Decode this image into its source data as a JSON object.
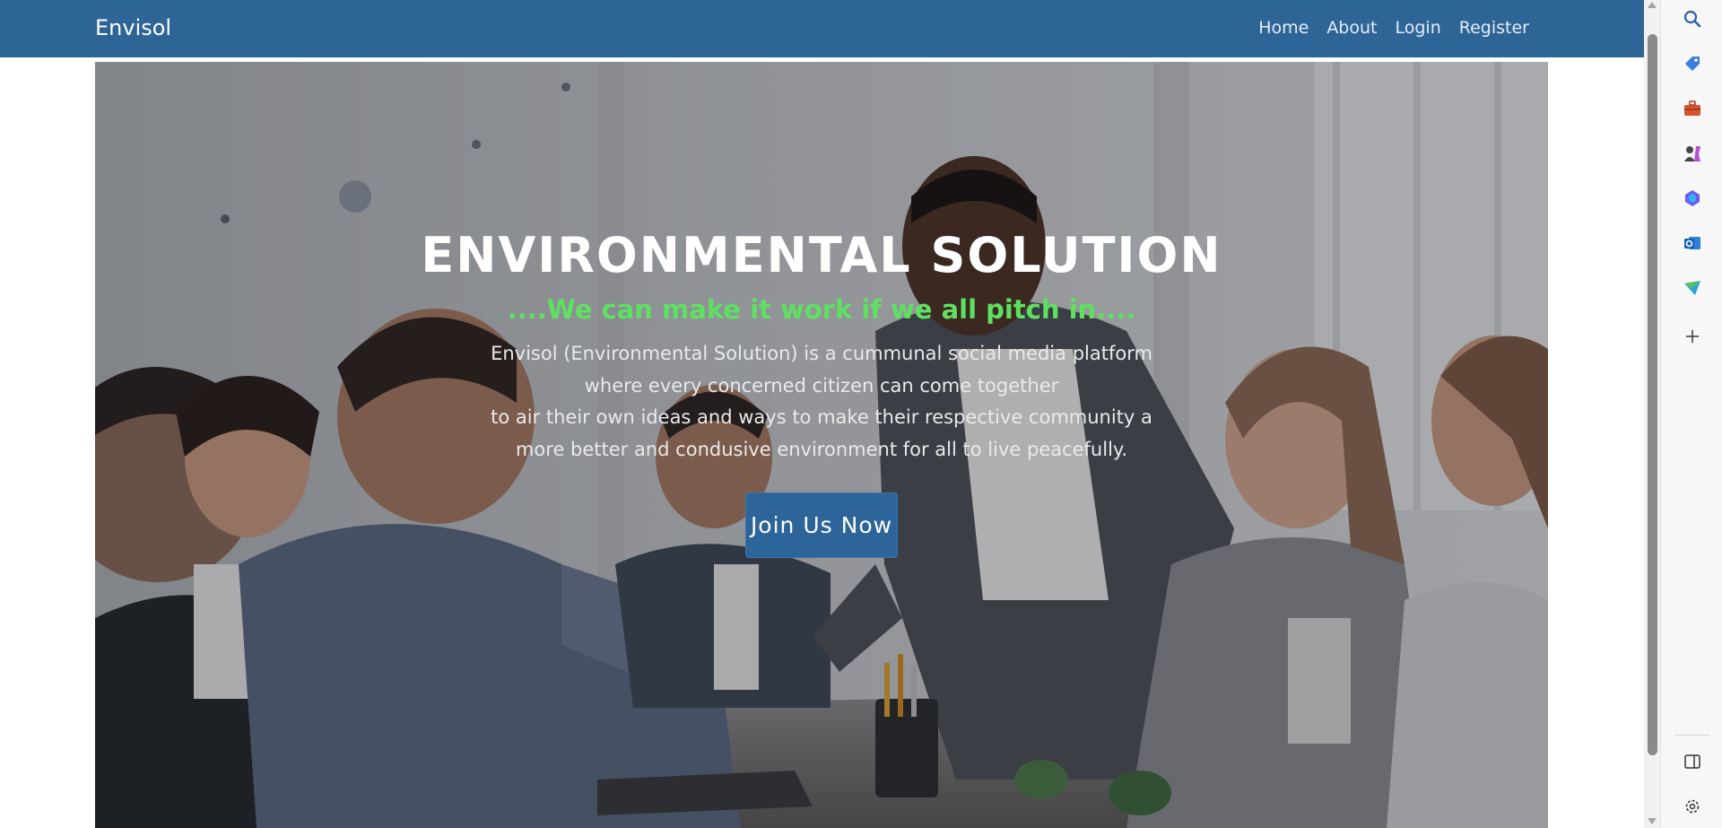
{
  "navbar": {
    "brand": "Envisol",
    "links": [
      "Home",
      "About",
      "Login",
      "Register"
    ]
  },
  "hero": {
    "title": "ENVIRONMENTAL SOLUTION",
    "tagline": "....We can make it work if we all pitch in....",
    "description_lines": [
      "Envisol (Environmental Solution) is a cummunal social media platform",
      "where every concerned citizen can come together",
      "to air their own ideas and ways to make their respective community a",
      "more better and condusive environment for all to live peacefully."
    ],
    "cta_label": "Join Us Now"
  },
  "colors": {
    "navbar": "#2e6597",
    "tagline": "#5fe060",
    "cta": "#2d6499"
  },
  "browser_sidebar": {
    "icons": [
      "search-icon",
      "shopping-tag-icon",
      "briefcase-icon",
      "games-icon",
      "copilot-icon",
      "outlook-icon",
      "send-icon",
      "add-icon",
      "sidebar-toggle-icon",
      "settings-icon"
    ]
  }
}
